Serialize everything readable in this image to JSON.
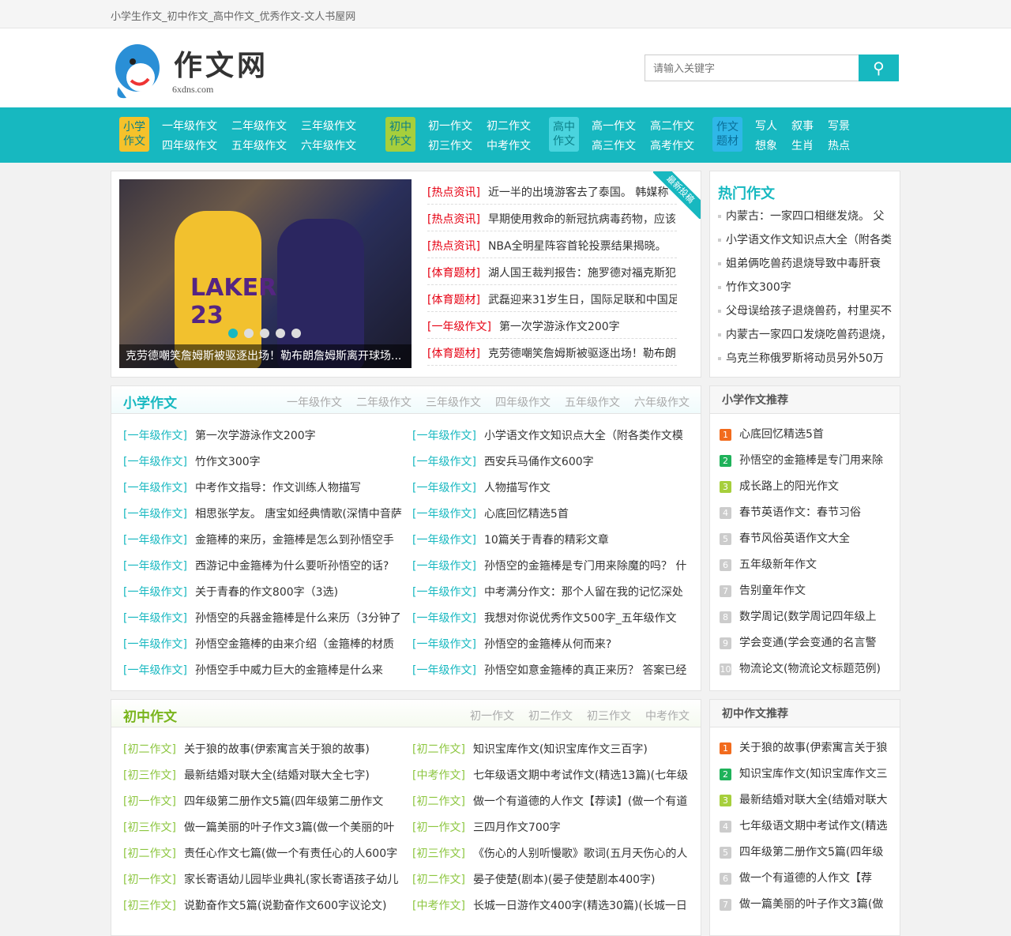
{
  "topbar": {
    "title": "小学生作文_初中作文_高中作文_优秀作文-文人书屋网"
  },
  "logo": {
    "name": "作文网",
    "domain": "6xdns.com"
  },
  "search": {
    "placeholder": "请输入关键字",
    "icon": "search-icon"
  },
  "nav": [
    {
      "badge": [
        "小学",
        "作文"
      ],
      "color": "#f5c22b",
      "text": "#0a7f88",
      "links": [
        "一年级作文",
        "四年级作文",
        "二年级作文",
        "五年级作文",
        "三年级作文",
        "六年级作文"
      ]
    },
    {
      "badge": [
        "初中",
        "作文"
      ],
      "color": "#a6cf3c",
      "text": "#0a7f88",
      "links": [
        "初一作文",
        "初三作文",
        "初二作文",
        "中考作文"
      ]
    },
    {
      "badge": [
        "高中",
        "作文"
      ],
      "color": "#4ad4de",
      "text": "#0a7f88",
      "links": [
        "高一作文",
        "高三作文",
        "高二作文",
        "高考作文"
      ]
    },
    {
      "badge": [
        "作文",
        "题材"
      ],
      "color": "#2fb7e8",
      "text": "#0a6f98",
      "links": [
        "写人",
        "想象",
        "叙事",
        "生肖",
        "写景",
        "热点"
      ]
    }
  ],
  "slider": {
    "caption": "克劳德嘲笑詹姆斯被驱逐出场！勒布朗詹姆斯离开球场...",
    "jersey": "LAKERS 23",
    "slides": 5,
    "active": 1
  },
  "ribbon": "最新投稿",
  "news": [
    [
      "[热点资讯]",
      "近一半的出境游客去了泰国。 韩媒称"
    ],
    [
      "[热点资讯]",
      "早期使用救命的新冠抗病毒药物，应该"
    ],
    [
      "[热点资讯]",
      "NBA全明星阵容首轮投票结果揭晓。"
    ],
    [
      "[体育题材]",
      "湖人国王裁判报告：施罗德对福克斯犯"
    ],
    [
      "[体育题材]",
      "武磊迎来31岁生日，国际足联和中国足"
    ],
    [
      "[一年级作文]",
      "第一次学游泳作文200字"
    ],
    [
      "[体育题材]",
      "克劳德嘲笑詹姆斯被驱逐出场！勒布朗"
    ]
  ],
  "hot": {
    "title": "热门作文",
    "items": [
      "内蒙古：一家四口相继发烧。 父",
      "小学语文作文知识点大全（附各类",
      "姐弟俩吃兽药退烧导致中毒肝衰",
      "竹作文300字",
      "父母误给孩子退烧兽药，村里买不",
      "内蒙古一家四口发烧吃兽药退烧，",
      "乌克兰称俄罗斯将动员另外50万"
    ]
  },
  "primary": {
    "title": "小学作文",
    "tabs": [
      "一年级作文",
      "二年级作文",
      "三年级作文",
      "四年级作文",
      "五年级作文",
      "六年级作文"
    ],
    "items": [
      [
        "[一年级作文]",
        "第一次学游泳作文200字"
      ],
      [
        "[一年级作文]",
        "小学语文作文知识点大全（附各类作文模"
      ],
      [
        "[一年级作文]",
        "竹作文300字"
      ],
      [
        "[一年级作文]",
        "西安兵马俑作文600字"
      ],
      [
        "[一年级作文]",
        "中考作文指导：作文训练人物描写"
      ],
      [
        "[一年级作文]",
        "人物描写作文"
      ],
      [
        "[一年级作文]",
        "相思张学友。 唐宝如经典情歌(深情中音萨"
      ],
      [
        "[一年级作文]",
        "心底回忆精选5首"
      ],
      [
        "[一年级作文]",
        "金箍棒的来历，金箍棒是怎么到孙悟空手"
      ],
      [
        "[一年级作文]",
        "10篇关于青春的精彩文章"
      ],
      [
        "[一年级作文]",
        "西游记中金箍棒为什么要听孙悟空的话?"
      ],
      [
        "[一年级作文]",
        "孙悟空的金箍棒是专门用来除魔的吗？ 什"
      ],
      [
        "[一年级作文]",
        "关于青春的作文800字（3选)"
      ],
      [
        "[一年级作文]",
        "中考满分作文：那个人留在我的记忆深处"
      ],
      [
        "[一年级作文]",
        "孙悟空的兵器金箍棒是什么来历（3分钟了"
      ],
      [
        "[一年级作文]",
        "我想对你说优秀作文500字_五年级作文"
      ],
      [
        "[一年级作文]",
        "孙悟空金箍棒的由来介绍（金箍棒的材质"
      ],
      [
        "[一年级作文]",
        "孙悟空的金箍棒从何而来?"
      ],
      [
        "[一年级作文]",
        "孙悟空手中威力巨大的金箍棒是什么来"
      ],
      [
        "[一年级作文]",
        "孙悟空如意金箍棒的真正来历？ 答案已经"
      ]
    ]
  },
  "middle": {
    "title": "初中作文",
    "tabs": [
      "初一作文",
      "初二作文",
      "初三作文",
      "中考作文"
    ],
    "items": [
      [
        "[初二作文]",
        "关于狼的故事(伊索寓言关于狼的故事)"
      ],
      [
        "[初二作文]",
        "知识宝库作文(知识宝库作文三百字)"
      ],
      [
        "[初三作文]",
        "最新结婚对联大全(结婚对联大全七字)"
      ],
      [
        "[中考作文]",
        "七年级语文期中考试作文(精选13篇)(七年级"
      ],
      [
        "[初一作文]",
        "四年级第二册作文5篇(四年级第二册作文"
      ],
      [
        "[初二作文]",
        "做一个有道德的人作文【荐读】(做一个有道"
      ],
      [
        "[初三作文]",
        "做一篇美丽的叶子作文3篇(做一个美丽的叶"
      ],
      [
        "[初一作文]",
        "三四月作文700字"
      ],
      [
        "[初二作文]",
        "责任心作文七篇(做一个有责任心的人600字"
      ],
      [
        "[初三作文]",
        "《伤心的人别听慢歌》歌词(五月天伤心的人"
      ],
      [
        "[初一作文]",
        "家长寄语幼儿园毕业典礼(家长寄语孩子幼儿"
      ],
      [
        "[初二作文]",
        "晏子使楚(剧本)(晏子使楚剧本400字)"
      ],
      [
        "[初三作文]",
        "说勤奋作文5篇(说勤奋作文600字议论文)"
      ],
      [
        "[中考作文]",
        "长城一日游作文400字(精选30篇)(长城一日"
      ]
    ]
  },
  "rec_primary": {
    "title": "小学作文推荐",
    "items": [
      "心底回忆精选5首",
      "孙悟空的金箍棒是专门用来除",
      "成长路上的阳光作文",
      "春节英语作文：春节习俗",
      "春节风俗英语作文大全",
      "五年级新年作文",
      "告别童年作文",
      "数学周记(数学周记四年级上",
      "学会变通(学会变通的名言警",
      "物流论文(物流论文标题范例)"
    ]
  },
  "rec_middle": {
    "title": "初中作文推荐",
    "items": [
      "关于狼的故事(伊索寓言关于狼",
      "知识宝库作文(知识宝库作文三",
      "最新结婚对联大全(结婚对联大",
      "七年级语文期中考试作文(精选",
      "四年级第二册作文5篇(四年级",
      "做一个有道德的人作文【荐",
      "做一篇美丽的叶子作文3篇(做"
    ]
  },
  "colors": {
    "accent": "#17b8c0",
    "primary_tag": "#17b8c0",
    "middle_tag": "#8cc63f",
    "hot_tag": "#e60012",
    "rank": [
      "#f26b1d",
      "#1fb25a",
      "#a6cf3c"
    ]
  }
}
